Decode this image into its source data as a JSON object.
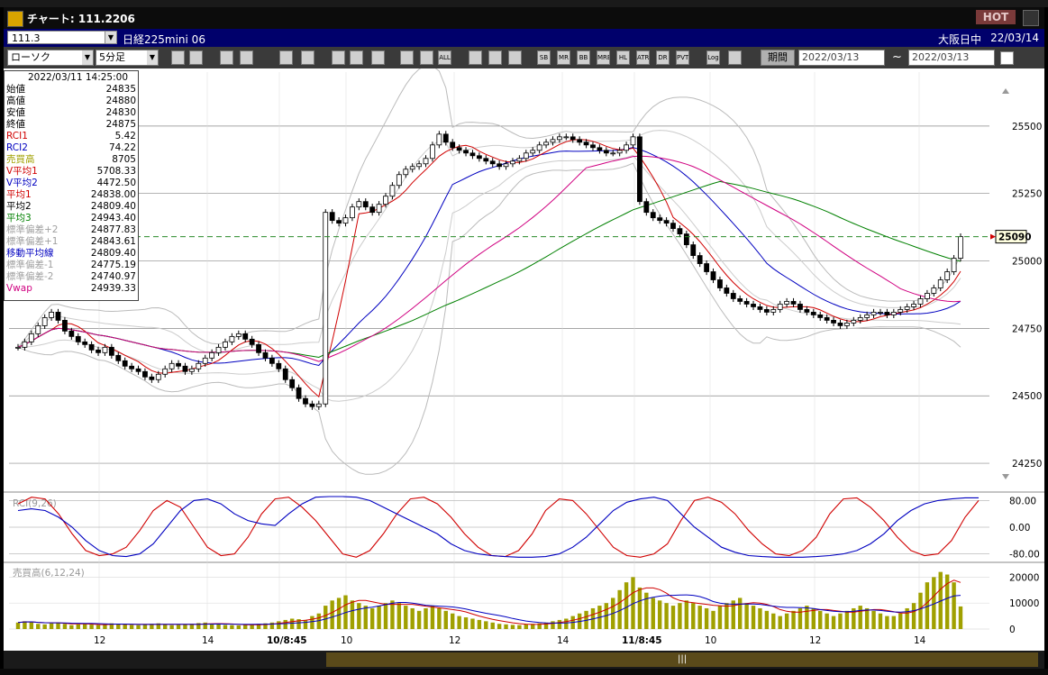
{
  "window": {
    "title": "チャート: 111.2206",
    "hot_label": "HOT"
  },
  "symbol_bar": {
    "code": "111.3",
    "name": "日経225mini 06",
    "session": "大阪日中",
    "date": "22/03/14"
  },
  "toolbar": {
    "chart_type": "ローソク",
    "timeframe": "5分足",
    "tool_icons": [
      "zoom-icon",
      "crosshair-icon",
      "cursor-icon",
      "magnify-icon",
      "compare-icon",
      "grid-icon",
      "pen-icon",
      "select-icon",
      "redo-icon",
      "candle-icon",
      "candle2-icon",
      "all-icon",
      "settings-icon",
      "tool-icon",
      "color-icon",
      "sb-icon",
      "mr-icon",
      "bb-icon",
      "mre-icon",
      "hl-icon",
      "atr-icon",
      "ra-icon",
      "pvt-icon",
      "log-icon",
      "export-icon"
    ],
    "tool_labels": [
      "",
      "",
      "",
      "",
      "",
      "",
      "",
      "",
      "",
      "",
      "",
      "ALL",
      "",
      "",
      "",
      "SB",
      "MR",
      "BB",
      "MRE",
      "HL",
      "ATR",
      "DR",
      "PVT",
      "Log",
      ""
    ],
    "period_label": "期間",
    "date_from": "2022/03/13",
    "date_to": "2022/03/13",
    "date_sep": "~"
  },
  "info_panel": {
    "datetime": "2022/03/11 14:25:00",
    "rows": [
      {
        "label": "始値",
        "value": "24835",
        "color": "#000000"
      },
      {
        "label": "高値",
        "value": "24880",
        "color": "#000000"
      },
      {
        "label": "安値",
        "value": "24830",
        "color": "#000000"
      },
      {
        "label": "終値",
        "value": "24875",
        "color": "#000000"
      },
      {
        "label": "RCI1",
        "value": "5.42",
        "color": "#d00000"
      },
      {
        "label": "RCI2",
        "value": "74.22",
        "color": "#0000c0"
      },
      {
        "label": "売買高",
        "value": "8705",
        "color": "#a0a000"
      },
      {
        "label": "V平均1",
        "value": "5708.33",
        "color": "#d00000"
      },
      {
        "label": "V平均2",
        "value": "4472.50",
        "color": "#0000c0"
      },
      {
        "label": "平均1",
        "value": "24838.00",
        "color": "#d00000"
      },
      {
        "label": "平均2",
        "value": "24809.40",
        "color": "#000000"
      },
      {
        "label": "平均3",
        "value": "24943.40",
        "color": "#008000"
      },
      {
        "label": "標準偏差+2",
        "value": "24877.83",
        "color": "#a0a0a0"
      },
      {
        "label": "標準偏差+1",
        "value": "24843.61",
        "color": "#a0a0a0"
      },
      {
        "label": "移動平均線",
        "value": "24809.40",
        "color": "#0000c0"
      },
      {
        "label": "標準偏差-1",
        "value": "24775.19",
        "color": "#a0a0a0"
      },
      {
        "label": "標準偏差-2",
        "value": "24740.97",
        "color": "#a0a0a0"
      },
      {
        "label": "Vwap",
        "value": "24939.33",
        "color": "#d00080"
      }
    ]
  },
  "chart_data": [
    {
      "type": "candlestick",
      "panel": "price",
      "ylim": [
        24150,
        25700
      ],
      "yticks": [
        24250,
        24500,
        24750,
        25000,
        25250,
        25500
      ],
      "current_price": "25090",
      "current_value": 25090,
      "close": [
        24680,
        24700,
        24730,
        24760,
        24790,
        24810,
        24780,
        24740,
        24720,
        24700,
        24690,
        24670,
        24660,
        24680,
        24650,
        24630,
        24610,
        24600,
        24590,
        24570,
        24560,
        24580,
        24600,
        24620,
        24610,
        24590,
        24600,
        24620,
        24640,
        24660,
        24680,
        24700,
        24720,
        24730,
        24710,
        24690,
        24660,
        24640,
        24620,
        24600,
        24560,
        24530,
        24490,
        24470,
        24460,
        24470,
        25180,
        25150,
        25140,
        25160,
        25200,
        25220,
        25200,
        25180,
        25210,
        25240,
        25280,
        25320,
        25340,
        25350,
        25360,
        25380,
        25430,
        25470,
        25440,
        25420,
        25410,
        25400,
        25390,
        25380,
        25370,
        25360,
        25350,
        25360,
        25370,
        25380,
        25400,
        25410,
        25430,
        25440,
        25450,
        25460,
        25460,
        25450,
        25440,
        25430,
        25420,
        25410,
        25400,
        25400,
        25410,
        25430,
        25460,
        25220,
        25180,
        25160,
        25150,
        25140,
        25120,
        25100,
        25060,
        25020,
        24990,
        24960,
        24930,
        24900,
        24880,
        24860,
        24850,
        24840,
        24830,
        24820,
        24810,
        24820,
        24840,
        24850,
        24840,
        24820,
        24810,
        24800,
        24790,
        24780,
        24770,
        24760,
        24770,
        24780,
        24790,
        24800,
        24810,
        24810,
        24800,
        24810,
        24820,
        24830,
        24840,
        24860,
        24880,
        24900,
        24930,
        24960,
        25010,
        25090
      ],
      "x_tick_labels": [
        "12",
        "14",
        "10/8:45",
        "10",
        "12",
        "14",
        "11/8:45",
        "10",
        "12",
        "14"
      ]
    },
    {
      "type": "line",
      "panel": "RCI",
      "title": "RCI(9,26)",
      "ylim": [
        -100,
        100
      ],
      "yticks": [
        "80.00",
        "0.00",
        "-80.00"
      ],
      "ytick_values": [
        80,
        0,
        -80
      ],
      "series": [
        {
          "name": "RCI1",
          "color": "#d00000",
          "values": [
            70,
            90,
            85,
            40,
            -20,
            -70,
            -85,
            -80,
            -60,
            -10,
            50,
            80,
            60,
            0,
            -60,
            -85,
            -80,
            -30,
            40,
            85,
            90,
            60,
            20,
            -30,
            -80,
            -90,
            -70,
            -20,
            40,
            85,
            90,
            70,
            30,
            -20,
            -60,
            -85,
            -88,
            -70,
            -20,
            50,
            85,
            80,
            40,
            -10,
            -60,
            -85,
            -90,
            -80,
            -50,
            20,
            80,
            90,
            75,
            40,
            -10,
            -50,
            -80,
            -85,
            -70,
            -30,
            40,
            85,
            88,
            60,
            20,
            -30,
            -70,
            -85,
            -80,
            -40,
            30,
            80
          ]
        },
        {
          "name": "RCI2",
          "color": "#0000c0",
          "values": [
            50,
            55,
            50,
            30,
            0,
            -40,
            -70,
            -85,
            -88,
            -80,
            -50,
            0,
            50,
            80,
            85,
            70,
            40,
            20,
            10,
            5,
            40,
            70,
            90,
            92,
            92,
            90,
            80,
            60,
            40,
            20,
            0,
            -20,
            -50,
            -70,
            -80,
            -85,
            -88,
            -90,
            -90,
            -88,
            -80,
            -60,
            -30,
            10,
            50,
            75,
            85,
            90,
            80,
            40,
            0,
            -30,
            -60,
            -75,
            -85,
            -88,
            -90,
            -90,
            -90,
            -88,
            -85,
            -80,
            -70,
            -50,
            -20,
            20,
            50,
            70,
            80,
            85,
            88,
            88
          ]
        }
      ]
    },
    {
      "type": "bar",
      "panel": "volume",
      "title": "売買高(6,12,24)",
      "ylim": [
        0,
        25000
      ],
      "yticks": [
        "20000",
        "10000",
        "0"
      ],
      "ytick_values": [
        20000,
        10000,
        0
      ],
      "values": [
        2500,
        3000,
        2800,
        2000,
        1800,
        2200,
        2500,
        2000,
        1500,
        1800,
        2000,
        1700,
        1500,
        1800,
        2200,
        2000,
        1800,
        1600,
        1500,
        1800,
        2000,
        2200,
        1800,
        1500,
        1600,
        1800,
        2000,
        2300,
        2500,
        2000,
        1800,
        1600,
        1500,
        1400,
        1600,
        1800,
        2000,
        2200,
        2500,
        3000,
        3500,
        4000,
        3800,
        3500,
        5000,
        6000,
        9000,
        11000,
        12000,
        13000,
        11000,
        10000,
        9000,
        8000,
        9000,
        10000,
        11000,
        10000,
        9000,
        8000,
        7000,
        8000,
        9000,
        8000,
        7000,
        6000,
        5000,
        4500,
        4000,
        3500,
        3000,
        2500,
        2000,
        1800,
        1600,
        1500,
        1800,
        2000,
        2200,
        2500,
        3000,
        3500,
        4000,
        5000,
        6000,
        7000,
        8000,
        9000,
        10000,
        12000,
        15000,
        18000,
        20000,
        16000,
        14000,
        12000,
        11000,
        10000,
        9000,
        10000,
        11000,
        10000,
        9000,
        8000,
        7000,
        9000,
        10000,
        11000,
        12000,
        10000,
        9000,
        8000,
        7000,
        6000,
        5000,
        6000,
        7000,
        8000,
        9000,
        8000,
        7000,
        6000,
        5000,
        6000,
        7000,
        8000,
        9000,
        8000,
        7000,
        6000,
        5000,
        5000,
        6000,
        8000,
        10000,
        14000,
        18000,
        20000,
        22000,
        21000,
        18000,
        8705
      ]
    }
  ]
}
